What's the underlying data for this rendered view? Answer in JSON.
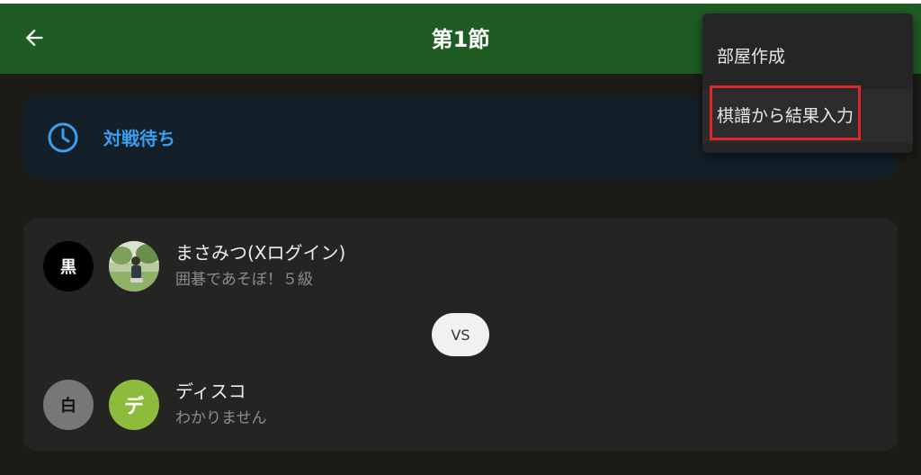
{
  "appbar": {
    "title": "第1節",
    "back_icon": "arrow-left-icon",
    "background": "#1f5c24"
  },
  "status": {
    "label": "対戦待ち",
    "icon": "clock-icon",
    "color": "#3b9ef0"
  },
  "match": {
    "black": {
      "color_label": "黒",
      "name": "まさみつ(Xログイン)",
      "subtitle": "囲碁であそぼ！５級",
      "avatar": "photo"
    },
    "vs_label": "VS",
    "white": {
      "color_label": "白",
      "name": "ディスコ",
      "subtitle": "わかりません",
      "avatar_letter": "デ",
      "avatar_color": "#8dbc3c"
    }
  },
  "menu": {
    "items": [
      {
        "label": "部屋作成"
      },
      {
        "label": "棋譜から結果入力",
        "highlighted": true
      }
    ],
    "highlight_color": "#e0262d"
  }
}
